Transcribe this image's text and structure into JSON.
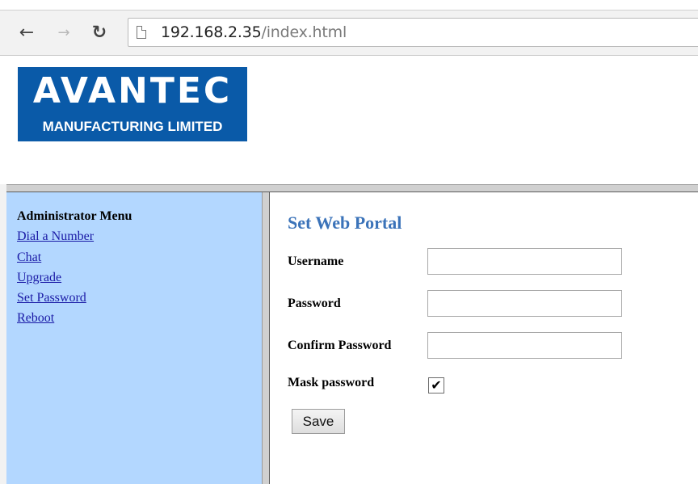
{
  "browser": {
    "url_host": "192.168.2.35",
    "url_path": "/index.html"
  },
  "logo": {
    "brand": "AVANTEC",
    "subtitle": "MANUFACTURING LIMITED",
    "color": "#0a5aa8"
  },
  "sidebar": {
    "title": "Administrator Menu",
    "links": [
      "Dial a Number",
      "Chat",
      "Upgrade",
      "Set Password",
      "Reboot"
    ],
    "background": "#b3d7ff"
  },
  "form": {
    "heading": "Set Web Portal",
    "username_label": "Username",
    "username_value": "",
    "password_label": "Password",
    "password_value": "",
    "confirm_label": "Confirm Password",
    "confirm_value": "",
    "mask_label": "Mask password",
    "mask_checked": true,
    "save_label": "Save"
  },
  "icons": {
    "back": "back-arrow-icon",
    "forward": "forward-arrow-icon",
    "reload": "reload-icon",
    "page": "page-icon",
    "check": "checkmark-icon"
  }
}
